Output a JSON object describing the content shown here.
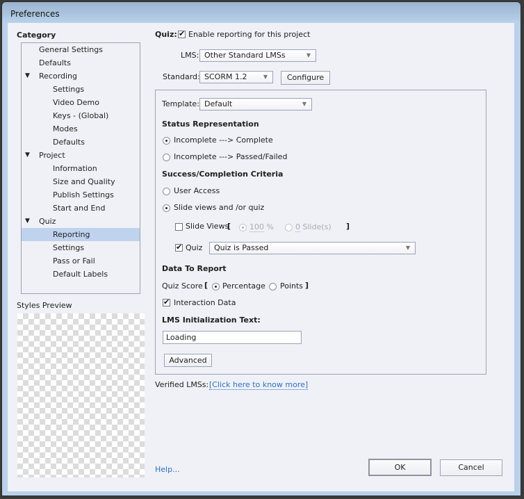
{
  "window": {
    "title": "Preferences"
  },
  "sidebar": {
    "heading": "Category",
    "items": [
      {
        "label": "General Settings",
        "level": 1
      },
      {
        "label": "Defaults",
        "level": 1
      },
      {
        "label": "Recording",
        "level": 1,
        "expanded": true
      },
      {
        "label": "Settings",
        "level": 2
      },
      {
        "label": "Video Demo",
        "level": 2
      },
      {
        "label": "Keys - (Global)",
        "level": 2
      },
      {
        "label": "Modes",
        "level": 2
      },
      {
        "label": "Defaults",
        "level": 2
      },
      {
        "label": "Project",
        "level": 1,
        "expanded": true
      },
      {
        "label": "Information",
        "level": 2
      },
      {
        "label": "Size and Quality",
        "level": 2
      },
      {
        "label": "Publish Settings",
        "level": 2
      },
      {
        "label": "Start and End",
        "level": 2
      },
      {
        "label": "Quiz",
        "level": 1,
        "expanded": true
      },
      {
        "label": "Reporting",
        "level": 2,
        "selected": true
      },
      {
        "label": "Settings",
        "level": 2
      },
      {
        "label": "Pass or Fail",
        "level": 2
      },
      {
        "label": "Default Labels",
        "level": 2
      }
    ],
    "expand_icon": "▼",
    "styles_preview_label": "Styles Preview"
  },
  "main": {
    "quiz_label": "Quiz:",
    "enable_reporting": {
      "label": "Enable reporting for this project",
      "checked": true
    },
    "lms": {
      "label": "LMS:",
      "value": "Other Standard LMSs"
    },
    "standard": {
      "label": "Standard:",
      "value": "SCORM 1.2"
    },
    "configure_label": "Configure",
    "template": {
      "label": "Template:",
      "value": "Default"
    },
    "status_representation": {
      "heading": "Status Representation",
      "options": [
        {
          "label": "Incomplete ---> Complete",
          "selected": true
        },
        {
          "label": "Incomplete ---> Passed/Failed",
          "selected": false
        }
      ]
    },
    "success_criteria": {
      "heading": "Success/Completion Criteria",
      "options": [
        {
          "label": "User Access",
          "selected": false
        },
        {
          "label": "Slide views and /or quiz",
          "selected": true
        }
      ],
      "slide_views": {
        "label": "Slide Views",
        "checked": false,
        "open_bracket": "[",
        "close_bracket": "]",
        "percent_option": {
          "value": "100",
          "unit": "%",
          "selected": true
        },
        "slides_option": {
          "value": "0",
          "unit": "Slide(s)",
          "selected": false
        }
      },
      "quiz": {
        "label": "Quiz",
        "checked": true,
        "value": "Quiz is Passed"
      }
    },
    "data_to_report": {
      "heading": "Data To Report",
      "quiz_score_label": "Quiz Score",
      "open_bracket": "[",
      "close_bracket": "]",
      "options": [
        {
          "label": "Percentage",
          "selected": true
        },
        {
          "label": "Points",
          "selected": false
        }
      ],
      "interaction_data": {
        "label": "Interaction Data",
        "checked": true
      }
    },
    "lms_init": {
      "heading": "LMS Initialization Text:",
      "value": "Loading"
    },
    "advanced_label": "Advanced",
    "verified_lms": {
      "label": "Verified LMSs:",
      "link": "[Click here to know more]"
    }
  },
  "footer": {
    "help": "Help...",
    "ok": "OK",
    "cancel": "Cancel"
  }
}
